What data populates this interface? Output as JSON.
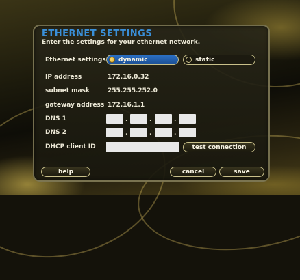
{
  "title": "ETHERNET SETTINGS",
  "subtitle": "Enter the settings for your ethernet network.",
  "ethernet_settings": {
    "label": "Ethernet settings",
    "options": [
      "dynamic",
      "static"
    ],
    "selected": "dynamic"
  },
  "ip_address": {
    "label": "IP address",
    "value": "172.16.0.32"
  },
  "subnet_mask": {
    "label": "subnet mask",
    "value": "255.255.252.0"
  },
  "gateway_address": {
    "label": "gateway address",
    "value": "172.16.1.1"
  },
  "dns1": {
    "label": "DNS 1",
    "octets": [
      "",
      "",
      "",
      ""
    ],
    "separator": "."
  },
  "dns2": {
    "label": "DNS 2",
    "octets": [
      "",
      "",
      "",
      ""
    ],
    "separator": "."
  },
  "dhcp_client_id": {
    "label": "DHCP client ID",
    "value": ""
  },
  "buttons": {
    "test_connection": "test connection",
    "help": "help",
    "cancel": "cancel",
    "save": "save"
  },
  "colors": {
    "title": "#3a8fd8",
    "selected_radio": "#2b6fc2",
    "text": "#ece8d6",
    "border": "#c9c08a"
  }
}
